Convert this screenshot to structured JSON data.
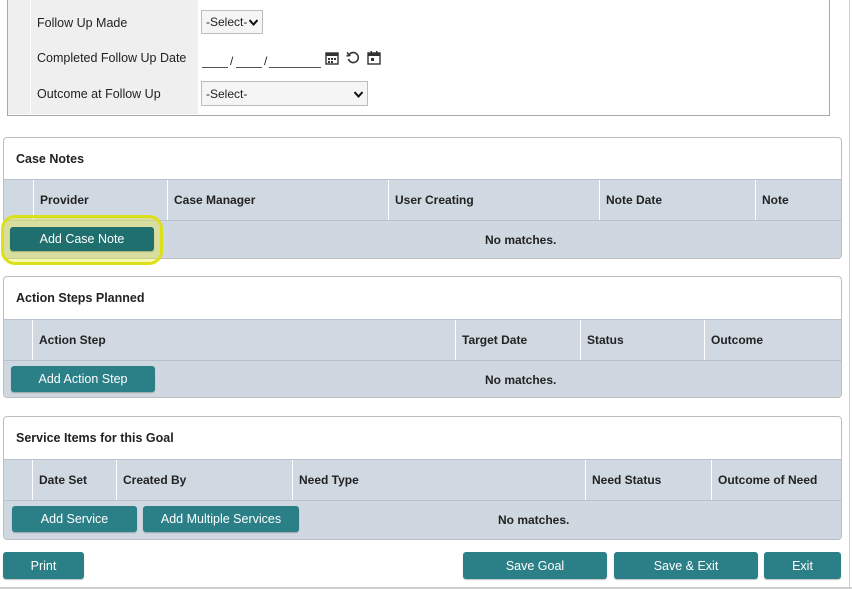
{
  "followup": {
    "row_made_label": "Follow Up Made",
    "row_made_value": "-Select-",
    "row_completed_label": "Completed Follow Up Date",
    "date_separator": "/",
    "row_outcome_label": "Outcome at Follow Up",
    "row_outcome_value": "-Select-"
  },
  "case_notes": {
    "title": "Case Notes",
    "columns": [
      "Provider",
      "Case Manager",
      "User Creating",
      "Note Date",
      "Note"
    ],
    "add_button": "Add Case Note",
    "empty_text": "No matches."
  },
  "action_steps": {
    "title": "Action Steps Planned",
    "columns": [
      "Action Step",
      "Target Date",
      "Status",
      "Outcome"
    ],
    "add_button": "Add Action Step",
    "empty_text": "No matches."
  },
  "service_items": {
    "title": "Service Items for this Goal",
    "columns": [
      "Date Set",
      "Created By",
      "Need Type",
      "Need Status",
      "Outcome of Need"
    ],
    "add_button": "Add Service",
    "add_multiple_button": "Add Multiple Services",
    "empty_text": "No matches."
  },
  "footer": {
    "print": "Print",
    "save_goal": "Save Goal",
    "save_exit": "Save & Exit",
    "exit": "Exit"
  },
  "colors": {
    "button": "#2b7f86",
    "table_header": "#d0d9e2",
    "highlight": "#e9ef23"
  }
}
